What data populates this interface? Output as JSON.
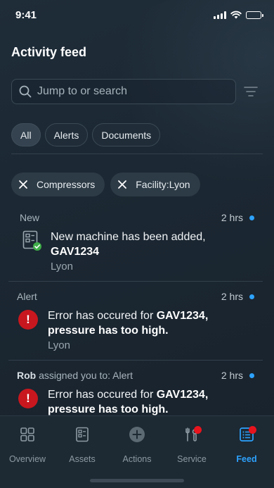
{
  "status_bar": {
    "time": "9:41"
  },
  "header": {
    "title": "Activity feed"
  },
  "search": {
    "placeholder": "Jump to or search"
  },
  "tabs": [
    {
      "label": "All",
      "active": true
    },
    {
      "label": "Alerts",
      "active": false
    },
    {
      "label": "Documents",
      "active": false
    }
  ],
  "filters": [
    {
      "label": "Compressors"
    },
    {
      "label": "Facility:Lyon"
    }
  ],
  "feed": [
    {
      "category": "New",
      "time": "2 hrs",
      "icon": "machine-added-icon",
      "message_prefix": "New machine has been added,",
      "message_bold": "GAV1234",
      "location": "Lyon"
    },
    {
      "category": "Alert",
      "time": "2 hrs",
      "icon": "error-icon",
      "message_prefix": "Error has occured for",
      "message_bold": "GAV1234,",
      "message_bold_2": "pressure has too high.",
      "location": "Lyon"
    },
    {
      "assigner": "Rob",
      "category": "assigned you to: Alert",
      "time": "2 hrs",
      "icon": "error-icon",
      "message_prefix": "Error has occured for",
      "message_bold": "GAV1234,",
      "message_bold_2": "pressure has too high."
    }
  ],
  "nav": [
    {
      "label": "Overview",
      "icon": "grid-icon",
      "active": false,
      "badge": false
    },
    {
      "label": "Assets",
      "icon": "assets-icon",
      "active": false,
      "badge": false
    },
    {
      "label": "Actions",
      "icon": "plus-circle-icon",
      "active": false,
      "badge": false
    },
    {
      "label": "Service",
      "icon": "wrench-icon",
      "active": false,
      "badge": true
    },
    {
      "label": "Feed",
      "icon": "feed-icon",
      "active": true,
      "badge": true
    }
  ],
  "colors": {
    "accent": "#2da3ff",
    "alert": "#c8171e",
    "success": "#3fae49",
    "badge": "#e8141d"
  }
}
